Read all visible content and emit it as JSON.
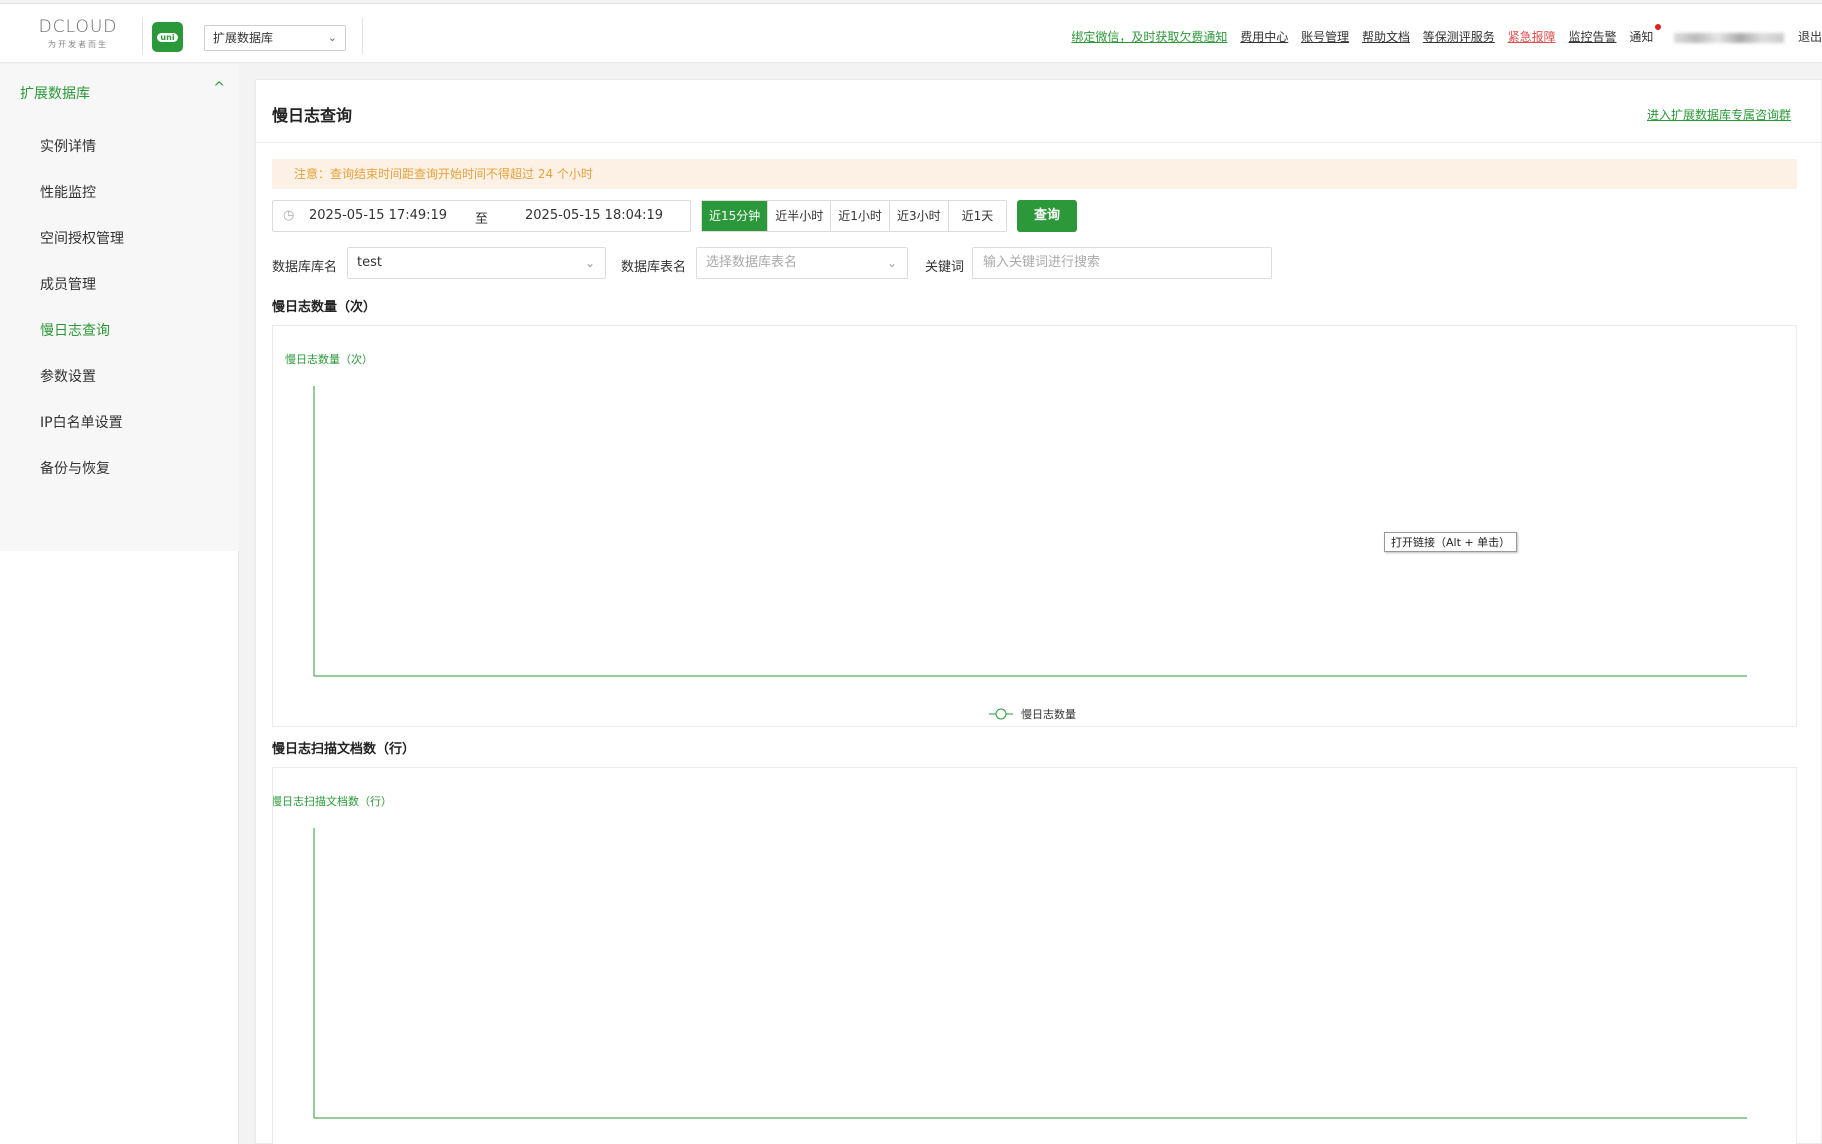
{
  "header": {
    "logo_word": "DCLOUD",
    "logo_sub": "为开发者而生",
    "uni_logo": "uni",
    "product_select": "扩展数据库",
    "links": [
      {
        "label": "绑定微信，及时获取欠费通知",
        "style": "green"
      },
      {
        "label": "费用中心",
        "style": "normal"
      },
      {
        "label": "账号管理",
        "style": "normal"
      },
      {
        "label": "帮助文档",
        "style": "normal"
      },
      {
        "label": "等保测评服务",
        "style": "normal"
      },
      {
        "label": "紧急报障",
        "style": "red"
      },
      {
        "label": "监控告警",
        "style": "normal"
      }
    ],
    "notify": "通知",
    "logout": "退出"
  },
  "sidebar": {
    "group_label": "扩展数据库",
    "items": [
      {
        "label": "实例详情",
        "active": false
      },
      {
        "label": "性能监控",
        "active": false
      },
      {
        "label": "空间授权管理",
        "active": false
      },
      {
        "label": "成员管理",
        "active": false
      },
      {
        "label": "慢日志查询",
        "active": true
      },
      {
        "label": "参数设置",
        "active": false
      },
      {
        "label": "IP白名单设置",
        "active": false
      },
      {
        "label": "备份与恢复",
        "active": false
      }
    ]
  },
  "main": {
    "title": "慢日志查询",
    "group_link": "进入扩展数据库专属咨询群",
    "notice": "注意：查询结束时间距查询开始时间不得超过 24 个小时",
    "date_start": "2025-05-15 17:49:19",
    "date_to": "至",
    "date_end": "2025-05-15 18:04:19",
    "ranges": [
      {
        "label": "近15分钟",
        "active": true
      },
      {
        "label": "近半小时",
        "active": false
      },
      {
        "label": "近1小时",
        "active": false
      },
      {
        "label": "近3小时",
        "active": false
      },
      {
        "label": "近1天",
        "active": false
      }
    ],
    "query_label": "查询",
    "db_name_label": "数据库库名",
    "db_name_value": "test",
    "table_label": "数据库表名",
    "table_placeholder": "选择数据库表名",
    "keyword_label": "关键词",
    "keyword_placeholder": "输入关键词进行搜索",
    "section1_title": "慢日志数量（次）",
    "section2_title": "慢日志扫描文档数（行）"
  },
  "tooltip": "打开链接（Alt + 单击）",
  "colors": {
    "accent": "#2b9939",
    "notice_bg": "#fdf1e5",
    "notice_text": "#e6a23c",
    "danger": "#e14d4d"
  },
  "chart_data": [
    {
      "type": "line",
      "title": "慢日志数量（次）",
      "series": [
        {
          "name": "慢日志数量",
          "values": []
        }
      ],
      "x": [],
      "grid": false,
      "legend": "bottom-center"
    },
    {
      "type": "line",
      "title": "慢日志扫描文档数（行）",
      "series": [],
      "x": [],
      "grid": false
    }
  ]
}
